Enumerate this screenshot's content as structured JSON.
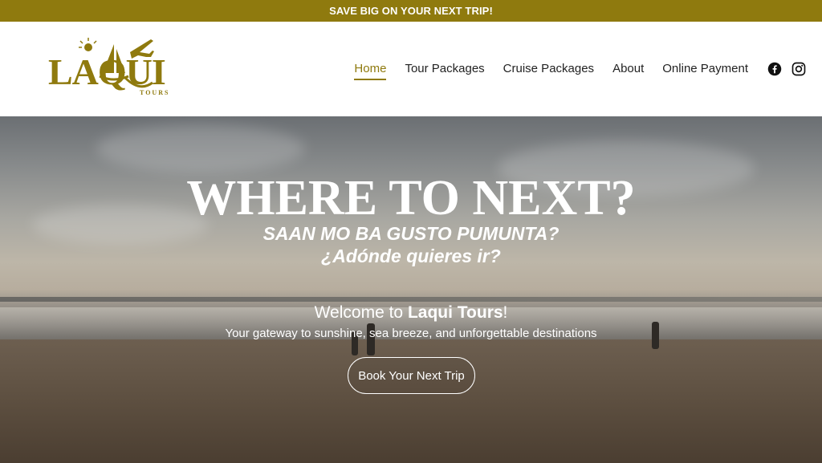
{
  "promo": {
    "text": "SAVE BIG ON YOUR NEXT TRIP!"
  },
  "brand": {
    "logo_text": "LAQUI",
    "logo_sub": "TOURS"
  },
  "nav": {
    "items": [
      {
        "label": "Home",
        "active": true
      },
      {
        "label": "Tour Packages"
      },
      {
        "label": "Cruise Packages"
      },
      {
        "label": "About"
      },
      {
        "label": "Online Payment"
      }
    ]
  },
  "social": {
    "icons": [
      "facebook-icon",
      "instagram-icon"
    ]
  },
  "hero": {
    "title": "WHERE TO NEXT?",
    "subtitle_1": "SAAN MO BA GUSTO PUMUNTA?",
    "subtitle_2": "¿Adónde quieres ir?",
    "welcome_prefix": "Welcome to ",
    "welcome_brand": "Laqui Tours",
    "welcome_suffix": "!",
    "tagline": "Your gateway to sunshine, sea breeze, and unforgettable destinations",
    "cta_label": "Book Your Next Trip"
  },
  "colors": {
    "brand": "#8f7a0e",
    "nav_text": "#222222",
    "hero_text": "#ffffff"
  }
}
